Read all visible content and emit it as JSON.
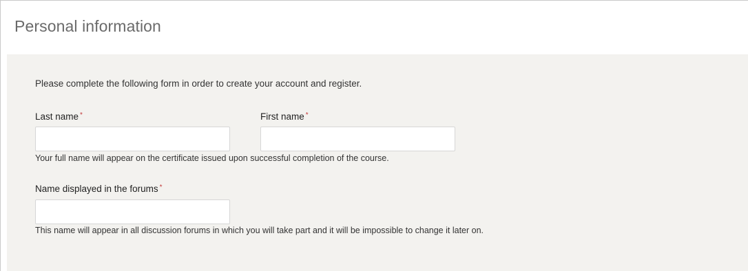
{
  "section": {
    "title": "Personal information"
  },
  "form": {
    "intro": "Please complete the following form in order to create your account and register.",
    "required_marker": "*",
    "last_name": {
      "label": "Last name",
      "value": ""
    },
    "first_name": {
      "label": "First name",
      "value": ""
    },
    "name_help": "Your full name will appear on the certificate issued upon successful completion of the course.",
    "forum_name": {
      "label": "Name displayed in the forums",
      "value": ""
    },
    "forum_help": "This name will appear in all discussion forums in which you will take part and it will be impossible to change it later on."
  },
  "colors": {
    "panel_background": "#f3f2ef",
    "required_marker": "#c23b3b",
    "title_text": "#6a6a6a"
  }
}
